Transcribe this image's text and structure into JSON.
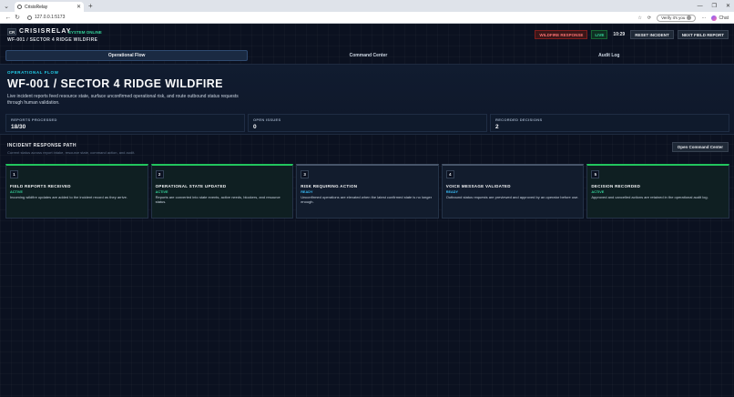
{
  "browser": {
    "tab_title": "CrisisRelay",
    "url": "127.0.0.1:5173",
    "verify_label": "Verify it's you",
    "chat_label": "Chat"
  },
  "header": {
    "logo": "CR",
    "brand": "CRISISRELAY",
    "system_status": "SYSTEM ONLINE",
    "incident": "WF-001 / SECTOR 4 RIDGE WILDFIRE",
    "mode_badge": "WILDFIRE RESPONSE",
    "live_badge": "LIVE",
    "clock": "10:29",
    "reset_label": "RESET INCIDENT",
    "next_label": "NEXT FIELD REPORT"
  },
  "tabs": [
    {
      "label": "Operational Flow"
    },
    {
      "label": "Command Center"
    },
    {
      "label": "Audit Log"
    }
  ],
  "hero": {
    "label": "OPERATIONAL FLOW",
    "title": "WF-001 / SECTOR 4 RIDGE WILDFIRE",
    "description": "Live incident reports feed resource state, surface unconfirmed operational risk, and route outbound status requests through human validation."
  },
  "stats": [
    {
      "label": "REPORTS PROCESSED",
      "value": "18/30"
    },
    {
      "label": "OPEN ISSUES",
      "value": "0"
    },
    {
      "label": "RECORDED DECISIONS",
      "value": "2"
    }
  ],
  "path": {
    "title": "INCIDENT RESPONSE PATH",
    "subtitle": "Current status across report intake, resource state, command action, and audit.",
    "open_button": "Open Command Center",
    "steps": [
      {
        "num": "1",
        "title": "FIELD REPORTS RECEIVED",
        "status": "ACTIVE",
        "desc": "Incoming wildfire updates are added to the incident record as they arrive."
      },
      {
        "num": "2",
        "title": "OPERATIONAL STATE UPDATED",
        "status": "ACTIVE",
        "desc": "Reports are converted into state events, active needs, blockers, and resource status."
      },
      {
        "num": "3",
        "title": "RISK REQUIRING ACTION",
        "status": "READY",
        "desc": "Unconfirmed operations are elevated when the latest confirmed state is no longer enough."
      },
      {
        "num": "4",
        "title": "VOICE MESSAGE VALIDATED",
        "status": "READY",
        "desc": "Outbound status requests are previewed and approved by an operator before use."
      },
      {
        "num": "5",
        "title": "DECISION RECORDED",
        "status": "ACTIVE",
        "desc": "Approved and cancelled actions are retained in the operational audit log."
      }
    ]
  }
}
